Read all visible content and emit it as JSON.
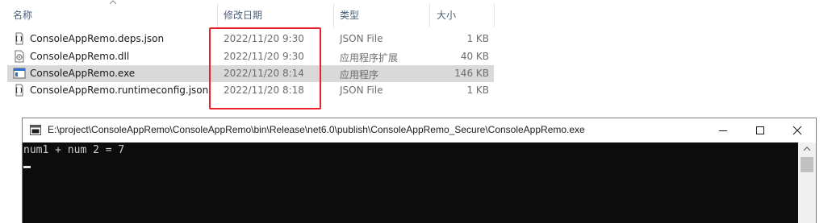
{
  "explorer": {
    "columns": {
      "name": "名称",
      "date_modified": "修改日期",
      "type": "类型",
      "size": "大小"
    },
    "files": [
      {
        "name": "ConsoleAppRemo.deps.json",
        "date": "2022/11/20 9:30",
        "type": "JSON File",
        "size": "1 KB",
        "icon": "json-file-icon",
        "selected": false
      },
      {
        "name": "ConsoleAppRemo.dll",
        "date": "2022/11/20 9:30",
        "type": "应用程序扩展",
        "size": "40 KB",
        "icon": "dll-file-icon",
        "selected": false
      },
      {
        "name": "ConsoleAppRemo.exe",
        "date": "2022/11/20 8:14",
        "type": "应用程序",
        "size": "146 KB",
        "icon": "exe-file-icon",
        "selected": true
      },
      {
        "name": "ConsoleAppRemo.runtimeconfig.json",
        "date": "2022/11/20 8:18",
        "type": "JSON File",
        "size": "1 KB",
        "icon": "json-file-icon",
        "selected": false
      }
    ],
    "highlight_color": "#e8212a",
    "selected_row_color": "#d9d9d9"
  },
  "console": {
    "title": "E:\\project\\ConsoleAppRemo\\ConsoleAppRemo\\bin\\Release\\net6.0\\publish\\ConsoleAppRemo_Secure\\ConsoleAppRemo.exe",
    "output": "num1 + num 2 = 7",
    "background": "#0c0c0c",
    "text_color": "#cccccc"
  }
}
